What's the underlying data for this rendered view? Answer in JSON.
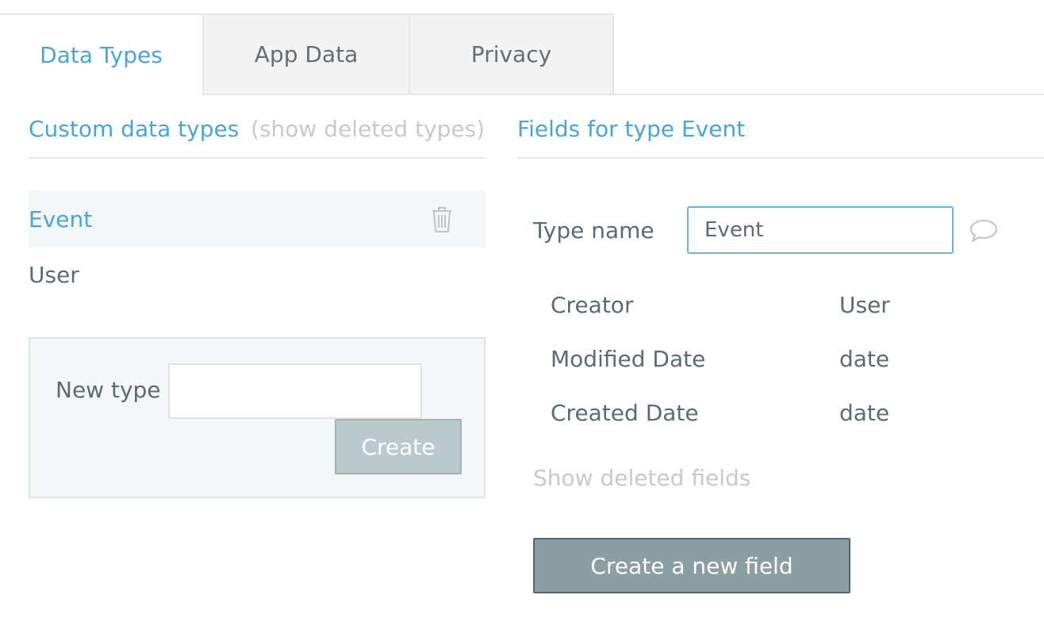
{
  "tabs": [
    {
      "label": "Data Types",
      "active": true
    },
    {
      "label": "App Data",
      "active": false
    },
    {
      "label": "Privacy",
      "active": false
    }
  ],
  "left_panel": {
    "title": "Custom data types",
    "show_deleted_label": "(show deleted types)",
    "types": [
      {
        "label": "Event",
        "selected": true
      },
      {
        "label": "User",
        "selected": false
      }
    ],
    "new_type": {
      "label": "New type",
      "value": "",
      "placeholder": "",
      "create_label": "Create"
    }
  },
  "right_panel": {
    "title": "Fields for type Event",
    "type_name_label": "Type name",
    "type_name_value": "Event",
    "fields": [
      {
        "name": "Creator",
        "type": "User"
      },
      {
        "name": "Modified Date",
        "type": "date"
      },
      {
        "name": "Created Date",
        "type": "date"
      }
    ],
    "show_deleted_fields": "Show deleted fields",
    "create_field_label": "Create a new field"
  },
  "colors": {
    "accent": "#4aa5d6",
    "text": "#5b6b72",
    "muted": "#c6cacc",
    "primary_button": "#8a9ea4",
    "disabled_button": "#bbc8cc"
  },
  "icons": {
    "delete": "trash-icon",
    "comment": "comment-icon"
  }
}
